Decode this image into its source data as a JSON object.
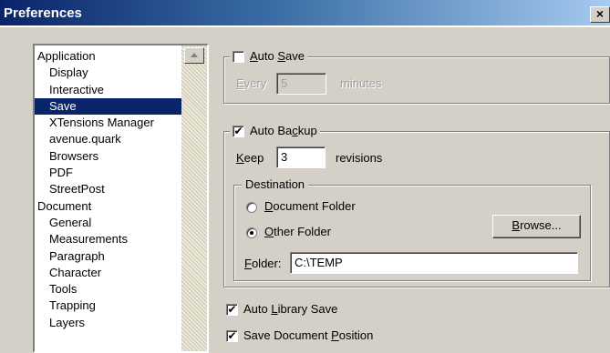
{
  "window": {
    "title": "Preferences",
    "close_glyph": "×"
  },
  "sidebar": {
    "items": [
      {
        "label": "Application",
        "level": 0,
        "selected": false
      },
      {
        "label": "Display",
        "level": 1,
        "selected": false
      },
      {
        "label": "Interactive",
        "level": 1,
        "selected": false
      },
      {
        "label": "Save",
        "level": 1,
        "selected": true
      },
      {
        "label": "XTensions Manager",
        "level": 1,
        "selected": false
      },
      {
        "label": "avenue.quark",
        "level": 1,
        "selected": false
      },
      {
        "label": "Browsers",
        "level": 1,
        "selected": false
      },
      {
        "label": "PDF",
        "level": 1,
        "selected": false
      },
      {
        "label": "StreetPost",
        "level": 1,
        "selected": false
      },
      {
        "label": "Document",
        "level": 0,
        "selected": false
      },
      {
        "label": "General",
        "level": 1,
        "selected": false
      },
      {
        "label": "Measurements",
        "level": 1,
        "selected": false
      },
      {
        "label": "Paragraph",
        "level": 1,
        "selected": false
      },
      {
        "label": "Character",
        "level": 1,
        "selected": false
      },
      {
        "label": "Tools",
        "level": 1,
        "selected": false
      },
      {
        "label": "Trapping",
        "level": 1,
        "selected": false
      },
      {
        "label": "Layers",
        "level": 1,
        "selected": false
      }
    ]
  },
  "auto_save": {
    "label": "Auto Save",
    "checked": false,
    "every_label": "Every",
    "every_value": "5",
    "minutes_label": "minutes"
  },
  "auto_backup": {
    "label": "Auto Backup",
    "checked": true,
    "keep_label": "Keep",
    "keep_value": "3",
    "revisions_label": "revisions",
    "destination": {
      "label": "Destination",
      "document_folder_label": "Document Folder",
      "other_folder_label": "Other Folder",
      "selected": "other_folder",
      "browse_label": "Browse...",
      "folder_label": "Folder:",
      "folder_value": "C:\\TEMP"
    }
  },
  "auto_library_save": {
    "label": "Auto Library Save",
    "checked": true
  },
  "save_document_position": {
    "label": "Save Document Position",
    "checked": true
  },
  "colors": {
    "selection": "#0a246a",
    "title_gradient_start": "#0a246a",
    "title_gradient_end": "#a6caf0",
    "face": "#d4d0c8"
  }
}
